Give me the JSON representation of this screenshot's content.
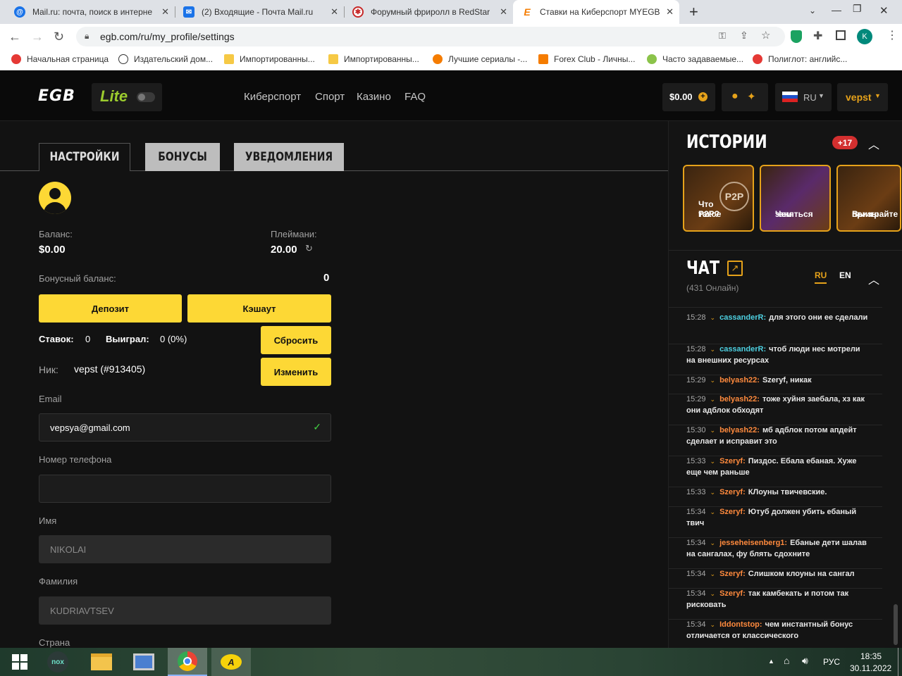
{
  "browser": {
    "tabs": [
      {
        "title": "Mail.ru: почта, поиск в интернете",
        "icon": "at-icon",
        "color": "#1a73e8"
      },
      {
        "title": "(2) Входящие - Почта Mail.ru",
        "icon": "mail-icon",
        "color": "#1a73e8"
      },
      {
        "title": "Форумный фриролл в RedStar P",
        "icon": "gear-icon",
        "color": "#c62828"
      },
      {
        "title": "Ставки на Киберспорт MYEGB.T",
        "icon": "egb-icon",
        "color": "#f57c00"
      }
    ],
    "url": "egb.com/ru/my_profile/settings",
    "profile_initial": "K",
    "bookmarks": [
      {
        "label": "Начальная страница",
        "color": "#e53935"
      },
      {
        "label": "Издательский дом...",
        "color": "#333333"
      },
      {
        "label": "Импортированны...",
        "color": "#f6c945"
      },
      {
        "label": "Импортированны...",
        "color": "#f6c945"
      },
      {
        "label": "Лучшие сериалы -...",
        "color": "#f57c00"
      },
      {
        "label": "Forex Club - Личны...",
        "color": "#f57c00"
      },
      {
        "label": "Часто задаваемые...",
        "color": "#8bc34a"
      },
      {
        "label": "Полиглот: английс...",
        "color": "#e53935"
      }
    ]
  },
  "site": {
    "logo": "EGB",
    "lite": "Lite",
    "nav": [
      "Киберспорт",
      "Спорт",
      "Казино",
      "FAQ"
    ],
    "balance": "$0.00",
    "lang": "RU",
    "user": "vepst"
  },
  "settings": {
    "tabs": [
      "НАСТРОЙКИ",
      "БОНУСЫ",
      "УВЕДОМЛЕНИЯ"
    ],
    "balance_label": "Баланс:",
    "balance_value": "$0.00",
    "playmoney_label": "Плеймани:",
    "playmoney_value": "20.00",
    "bonus_label": "Бонусный баланс:",
    "bonus_value": "0",
    "deposit": "Депозит",
    "cashout": "Кэшаут",
    "bets_label": "Ставок:",
    "bets_value": "0",
    "won_label": "Выиграл:",
    "won_value": "0 (0%)",
    "reset": "Сбросить",
    "nick_label": "Ник:",
    "nick_value": "vepst (#913405)",
    "change": "Изменить",
    "email_label": "Email",
    "email_value": "vepsya@gmail.com",
    "phone_label": "Номер телефона",
    "phone_value": "",
    "name_label": "Имя",
    "name_value": "NIKOLAI",
    "surname_label": "Фамилия",
    "surname_value": "KUDRIAVTSEV",
    "country_label": "Страна"
  },
  "stories": {
    "title": "ИСТОРИИ",
    "badge": "+17",
    "items": [
      {
        "line1": "Что такое",
        "line2": "P2P?",
        "art": "P2P"
      },
      {
        "line1": "Чем",
        "line2": "заняться",
        "art": ""
      },
      {
        "line1": "Выиграйте",
        "line2": "призы",
        "art": ""
      }
    ]
  },
  "chat": {
    "title": "ЧАТ",
    "online": "(431 Онлайн)",
    "lang_ru": "RU",
    "lang_en": "EN",
    "messages": [
      {
        "time": "15:28",
        "user": "cassanderR:",
        "text": "для этого они ее сделали",
        "color": "#4dd0e1"
      },
      {
        "time": "15:28",
        "user": "cassanderR:",
        "text": "чтоб люди нес мотрели на внешних ресурсах",
        "color": "#4dd0e1"
      },
      {
        "time": "15:29",
        "user": "belyash22:",
        "text": "Szeryf, никак",
        "color": "#ff8a3d"
      },
      {
        "time": "15:29",
        "user": "belyash22:",
        "text": "тоже хуйня заебала, хз как они адблок обходят",
        "color": "#ff8a3d"
      },
      {
        "time": "15:30",
        "user": "belyash22:",
        "text": "мб адблок потом апдейт сделает и исправит это",
        "color": "#ff8a3d"
      },
      {
        "time": "15:33",
        "user": "Szeryf:",
        "text": "Пиздос. Ебала ебаная. Хуже еще чем раньше",
        "color": "#ff8a3d"
      },
      {
        "time": "15:33",
        "user": "Szeryf:",
        "text": "КЛоуны твичевские.",
        "color": "#ff8a3d"
      },
      {
        "time": "15:34",
        "user": "Szeryf:",
        "text": "Ютуб должен убить ебаный твич",
        "color": "#ff8a3d"
      },
      {
        "time": "15:34",
        "user": "jesseheisenberg1:",
        "text": "Ебаные дети шалав на сангалах, фу блять сдохните",
        "color": "#ff8a3d"
      },
      {
        "time": "15:34",
        "user": "Szeryf:",
        "text": "Слишком клоуны на сангал",
        "color": "#ff8a3d"
      },
      {
        "time": "15:34",
        "user": "Szeryf:",
        "text": "так камбекать и потом так рисковать",
        "color": "#ff8a3d"
      },
      {
        "time": "15:34",
        "user": "Iddontstop:",
        "text": "чем инстантный бонус отличается от классического",
        "color": "#ff8a3d"
      }
    ]
  },
  "taskbar": {
    "lang": "РУС",
    "time": "18:35",
    "date": "30.11.2022"
  },
  "colors": {
    "accent": "#fdd835",
    "orange": "#e6a21a",
    "bg": "#121212"
  }
}
